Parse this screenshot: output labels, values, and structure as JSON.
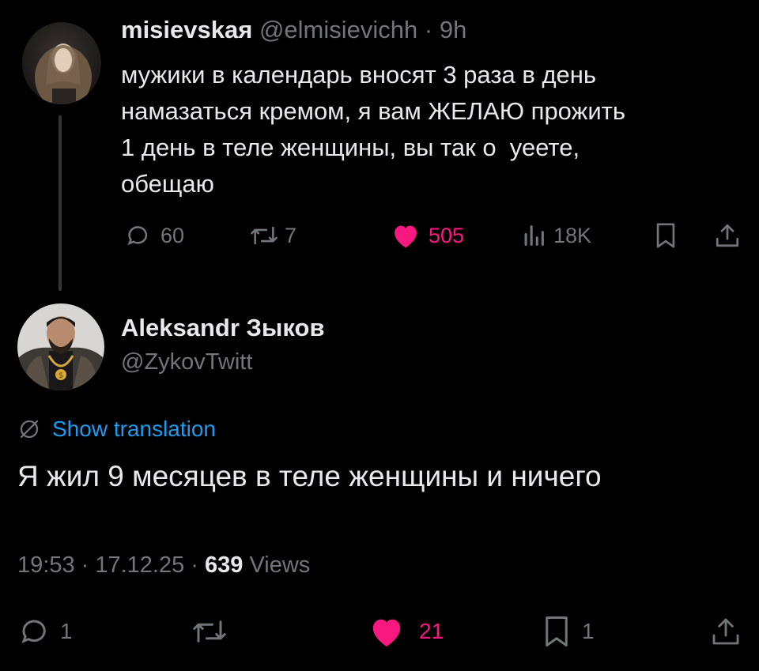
{
  "original_post": {
    "author_name": "misievskaя",
    "author_handle": "@elmisievichh",
    "separator": "·",
    "time_ago": "9h",
    "text_lines": [
      "мужики в календарь вносят 3 раза в день",
      "намазаться кремом, я вам ЖЕЛАЮ прожить",
      "1 день в теле женщины, вы так о  уеете,",
      "обещаю"
    ],
    "stats": {
      "replies": "60",
      "reposts": "7",
      "likes": "505",
      "views": "18K"
    }
  },
  "reply_post": {
    "author_name": "Aleksandr Зыков",
    "author_handle": "@ZykovTwitt",
    "translation_link": "Show translation",
    "text": "Я жил 9 месяцев в теле женщины и ничего",
    "time": "19:53",
    "separator_1": " · ",
    "date": "17.12.25",
    "separator_2": " · ",
    "views_count": "639",
    "views_label": " Views",
    "stats": {
      "replies": "1",
      "likes": "21",
      "bookmarks": "1"
    }
  },
  "colors": {
    "background": "#000000",
    "text_primary": "#e7e9ea",
    "text_secondary": "#71767b",
    "like_pink": "#f91880",
    "link_blue": "#1d9bf0",
    "thread_line": "#333639"
  },
  "icons": [
    "reply-icon",
    "repost-icon",
    "like-icon",
    "views-icon",
    "bookmark-icon",
    "share-icon",
    "translate-icon"
  ]
}
